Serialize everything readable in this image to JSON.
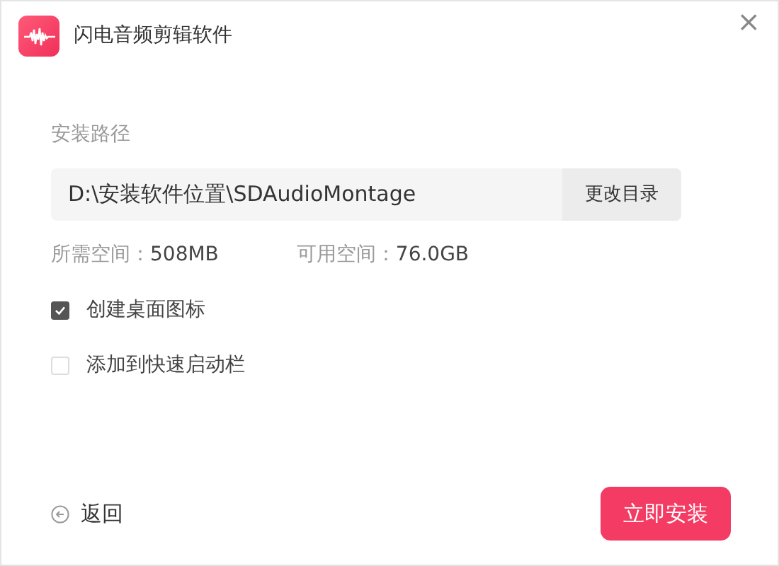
{
  "window": {
    "title": "闪电音频剪辑软件",
    "close": "×"
  },
  "install_path": {
    "label": "安装路径",
    "value": "D:\\安装软件位置\\SDAudioMontage",
    "change_button": "更改目录"
  },
  "space": [
    {
      "label": "所需空间：",
      "value": "508MB"
    },
    {
      "label": "可用空间：",
      "value": "76.0GB"
    }
  ],
  "options": [
    {
      "label": "创建桌面图标",
      "checked": true
    },
    {
      "label": "添加到快速启动栏",
      "checked": false
    }
  ],
  "footer": {
    "back": "返回",
    "install": "立即安装"
  }
}
